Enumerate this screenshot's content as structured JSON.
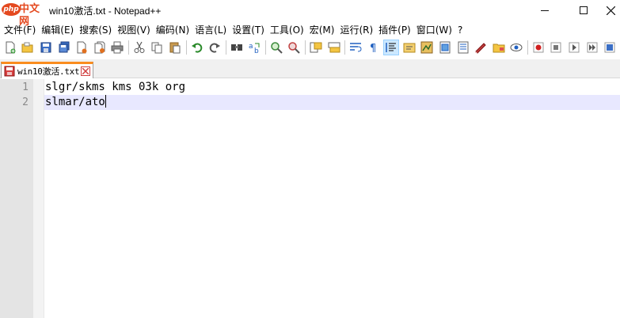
{
  "app": {
    "logo_text": "php",
    "logo_cn": "中文网",
    "window_title": "win10激活.txt - Notepad++"
  },
  "window_controls": {
    "minimize": "minimize",
    "maximize": "maximize",
    "close": "close"
  },
  "menu": {
    "items": [
      {
        "label": "文件(F)"
      },
      {
        "label": "编辑(E)"
      },
      {
        "label": "搜索(S)"
      },
      {
        "label": "视图(V)"
      },
      {
        "label": "编码(N)"
      },
      {
        "label": "语言(L)"
      },
      {
        "label": "设置(T)"
      },
      {
        "label": "工具(O)"
      },
      {
        "label": "宏(M)"
      },
      {
        "label": "运行(R)"
      },
      {
        "label": "插件(P)"
      },
      {
        "label": "窗口(W)"
      },
      {
        "label": "?"
      }
    ]
  },
  "toolbar": {
    "icons": [
      "new-file-icon",
      "open-file-icon",
      "save-icon",
      "save-all-icon",
      "close-icon",
      "close-all-icon",
      "print-icon",
      "cut-icon",
      "copy-icon",
      "paste-icon",
      "undo-icon",
      "redo-icon",
      "find-icon",
      "replace-icon",
      "zoom-in-icon",
      "zoom-out-icon",
      "sync-vertical-icon",
      "sync-horizontal-icon",
      "word-wrap-icon",
      "show-all-chars-icon",
      "indent-guide-icon",
      "user-language-icon",
      "document-map-icon",
      "function-list-icon",
      "folder-as-workspace-icon",
      "monitoring-icon",
      "record-macro-icon",
      "stop-macro-icon",
      "play-macro-icon",
      "run-macro-multiple-icon",
      "save-macro-icon"
    ],
    "active_icon": "indent-guide-icon"
  },
  "tabs": [
    {
      "label": "win10激活.txt",
      "modified": false
    }
  ],
  "editor": {
    "lines": [
      {
        "number": "1",
        "text": "slgr/skms kms 03k org"
      },
      {
        "number": "2",
        "text": "slmar/ato"
      }
    ],
    "current_line": 2
  },
  "colors": {
    "current_line_highlight": "#e8e8ff",
    "gutter": "#e4e4e4",
    "tab_accent": "#fa8c1e",
    "logo": "#e4491f"
  }
}
